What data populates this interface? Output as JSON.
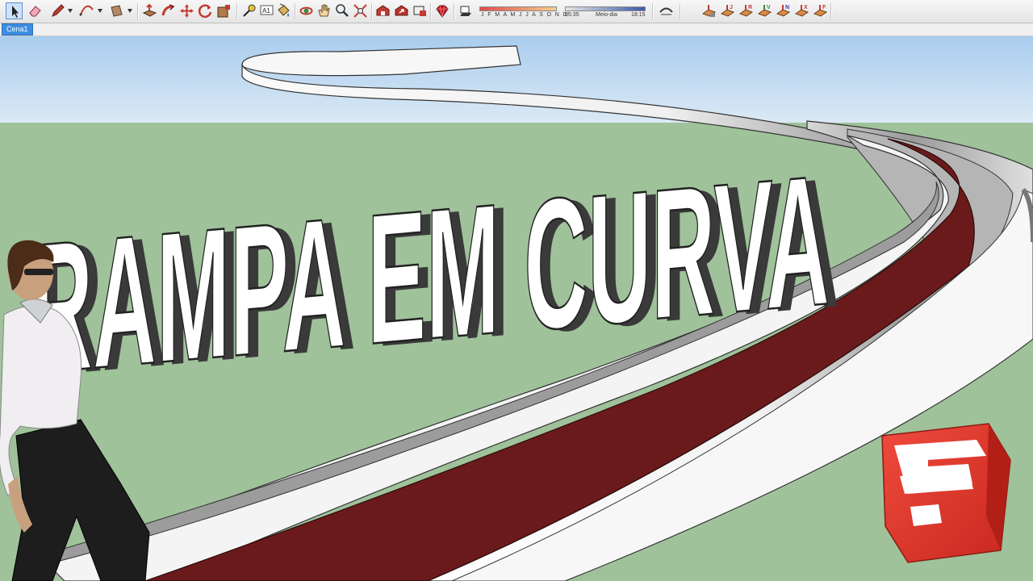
{
  "toolbar": {
    "tools": [
      {
        "name": "select-tool",
        "icon": "arrow-icon"
      },
      {
        "name": "eraser-tool",
        "icon": "eraser-icon"
      },
      {
        "name": "pencil-tool",
        "icon": "pencil-icon"
      },
      {
        "name": "arc-tool",
        "icon": "arc-icon"
      },
      {
        "name": "rectangle-tool",
        "icon": "rectangle-icon"
      },
      {
        "name": "push-pull-tool",
        "icon": "push-pull-icon"
      },
      {
        "name": "follow-me-tool",
        "icon": "follow-me-icon"
      },
      {
        "name": "move-tool",
        "icon": "move-icon"
      },
      {
        "name": "rotate-tool",
        "icon": "rotate-icon"
      },
      {
        "name": "scale-tool",
        "icon": "scale-icon"
      },
      {
        "name": "tape-measure-tool",
        "icon": "tape-measure-icon"
      },
      {
        "name": "text-tool",
        "icon": "text-icon"
      },
      {
        "name": "paint-bucket-tool",
        "icon": "paint-bucket-icon"
      },
      {
        "name": "orbit-tool",
        "icon": "orbit-icon"
      },
      {
        "name": "pan-tool",
        "icon": "pan-hand-icon"
      },
      {
        "name": "zoom-tool",
        "icon": "zoom-icon"
      },
      {
        "name": "zoom-extents-tool",
        "icon": "zoom-extents-icon"
      },
      {
        "name": "warehouse-tool",
        "icon": "warehouse-icon"
      },
      {
        "name": "share-model-tool",
        "icon": "share-model-icon"
      },
      {
        "name": "extension-warehouse-tool",
        "icon": "extension-warehouse-icon"
      },
      {
        "name": "ruby-tool",
        "icon": "ruby-icon"
      },
      {
        "name": "shadows-toggle",
        "icon": "shadows-icon"
      },
      {
        "name": "smooth-edges-tool",
        "icon": "smooth-icon"
      },
      {
        "name": "sandbox-from-contours-tool",
        "icon": "sandbox-contours-icon"
      },
      {
        "name": "sandbox-from-scratch-tool",
        "icon": "sandbox-scratch-icon"
      },
      {
        "name": "sandbox-smoove-tool",
        "icon": "sandbox-smoove-icon"
      },
      {
        "name": "sandbox-stamp-tool",
        "icon": "sandbox-stamp-icon"
      },
      {
        "name": "sandbox-drape-tool",
        "icon": "sandbox-drape-icon"
      },
      {
        "name": "sandbox-add-detail-tool",
        "icon": "sandbox-add-detail-icon"
      },
      {
        "name": "sandbox-flip-edge-tool",
        "icon": "sandbox-flip-edge-icon"
      }
    ],
    "tool_letters": {
      "text": "A1"
    },
    "sandbox_letters": [
      "J",
      "R",
      "V",
      "N",
      "X",
      "F"
    ],
    "shadow_months": "J F M A M J J A S O N D",
    "shadow_time_start": "05:35",
    "shadow_time_mid": "Meio-dia",
    "shadow_time_end": "18:15"
  },
  "scene_tab": {
    "label": "Cena1"
  },
  "title_text": "RAMPA EM CURVA",
  "colors": {
    "sky": "#cfe3f4",
    "ground": "#9fc29a",
    "ramp_surface": "#6b1a1c",
    "ramp_wall": "#f4f4f4",
    "logo_red": "#d9342b"
  }
}
